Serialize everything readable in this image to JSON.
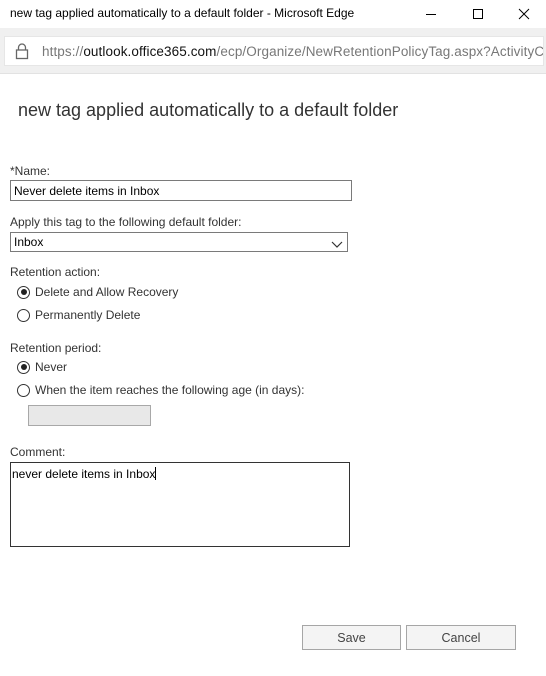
{
  "window": {
    "title": "new tag applied automatically to a default folder - Microsoft Edge",
    "minimize_icon": "minimize-icon",
    "maximize_icon": "maximize-icon",
    "close_icon": "close-icon"
  },
  "address_bar": {
    "lock_icon": "lock-icon",
    "url_prefix": "https://",
    "url_host": "outlook.office365.com",
    "url_path": "/ecp/Organize/NewRetentionPolicyTag.aspx?ActivityCorrel"
  },
  "page": {
    "title": "new tag applied automatically to a default folder"
  },
  "form": {
    "name_label": "*Name:",
    "name_value": "Never delete items in Inbox",
    "folder_label": "Apply this tag to the following default folder:",
    "folder_value": "Inbox",
    "retention_action_label": "Retention action:",
    "retention_actions": [
      {
        "label": "Delete and Allow Recovery",
        "checked": true
      },
      {
        "label": "Permanently Delete",
        "checked": false
      }
    ],
    "retention_period_label": "Retention period:",
    "retention_periods": [
      {
        "label": "Never",
        "checked": true
      },
      {
        "label": "When the item reaches the following age (in days):",
        "checked": false
      }
    ],
    "age_days_value": "",
    "comment_label": "Comment:",
    "comment_value": "never delete items in Inbox"
  },
  "buttons": {
    "save": "Save",
    "cancel": "Cancel"
  }
}
